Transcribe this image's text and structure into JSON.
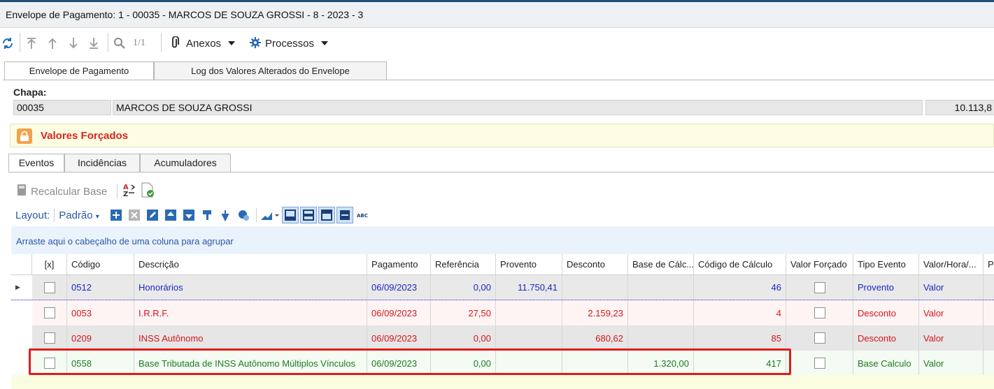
{
  "window": {
    "title": "Envelope de Pagamento: 1 - 00035 - MARCOS DE SOUZA GROSSI - 8 - 2023 - 3"
  },
  "toolbar": {
    "record_counter": "1/1",
    "attachments_label": "Anexos",
    "processes_label": "Processos"
  },
  "main_tabs": [
    {
      "label": "Envelope de Pagamento"
    },
    {
      "label": "Log dos Valores Alterados do Envelope"
    }
  ],
  "chapa": {
    "label": "Chapa:",
    "code": "00035",
    "name": "MARCOS DE SOUZA GROSSI",
    "amount": "10.113,8"
  },
  "forced_values": {
    "label": "Valores Forçados"
  },
  "sub_tabs": [
    {
      "label": "Eventos"
    },
    {
      "label": "Incidências"
    },
    {
      "label": "Acumuladores"
    }
  ],
  "actions": {
    "recalc_label": "Recalcular Base"
  },
  "layout": {
    "label": "Layout:",
    "preset": "Padrão"
  },
  "group_hint": "Arraste aqui o cabeçalho de uma coluna para agrupar",
  "grid": {
    "columns": [
      {
        "label": "[x]"
      },
      {
        "label": "Código"
      },
      {
        "label": "Descrição"
      },
      {
        "label": "Pagamento"
      },
      {
        "label": "Referência"
      },
      {
        "label": "Provento"
      },
      {
        "label": "Desconto"
      },
      {
        "label": "Base de Cálc..."
      },
      {
        "label": "Código de Cálculo"
      },
      {
        "label": "Valor Forçado"
      },
      {
        "label": "Tipo Evento"
      },
      {
        "label": "Valor/Hora/..."
      },
      {
        "label": "Pr"
      }
    ],
    "rows": [
      {
        "codigo": "0512",
        "descricao": "Honorários",
        "pagamento": "06/09/2023",
        "referencia": "0,00",
        "provento": "11.750,41",
        "desconto": "",
        "base": "",
        "codigo_calculo": "46",
        "tipo": "Provento",
        "valor_hora": "Valor",
        "color": "#1c27c4"
      },
      {
        "codigo": "0053",
        "descricao": "I.R.R.F.",
        "pagamento": "06/09/2023",
        "referencia": "27,50",
        "provento": "",
        "desconto": "2.159,23",
        "base": "",
        "codigo_calculo": "4",
        "tipo": "Desconto",
        "valor_hora": "Valor",
        "color": "#d4161c"
      },
      {
        "codigo": "0209",
        "descricao": "INSS Autônomo",
        "pagamento": "06/09/2023",
        "referencia": "0,00",
        "provento": "",
        "desconto": "680,62",
        "base": "",
        "codigo_calculo": "85",
        "tipo": "Desconto",
        "valor_hora": "Valor",
        "color": "#d4161c"
      },
      {
        "codigo": "0558",
        "descricao": "Base Tributada de INSS Autônomo Múltiplos Vínculos",
        "pagamento": "06/09/2023",
        "referencia": "0,00",
        "provento": "",
        "desconto": "",
        "base": "1.320,00",
        "codigo_calculo": "417",
        "tipo": "Base Calculo",
        "valor_hora": "Valor",
        "color": "#1e7a23"
      }
    ]
  }
}
